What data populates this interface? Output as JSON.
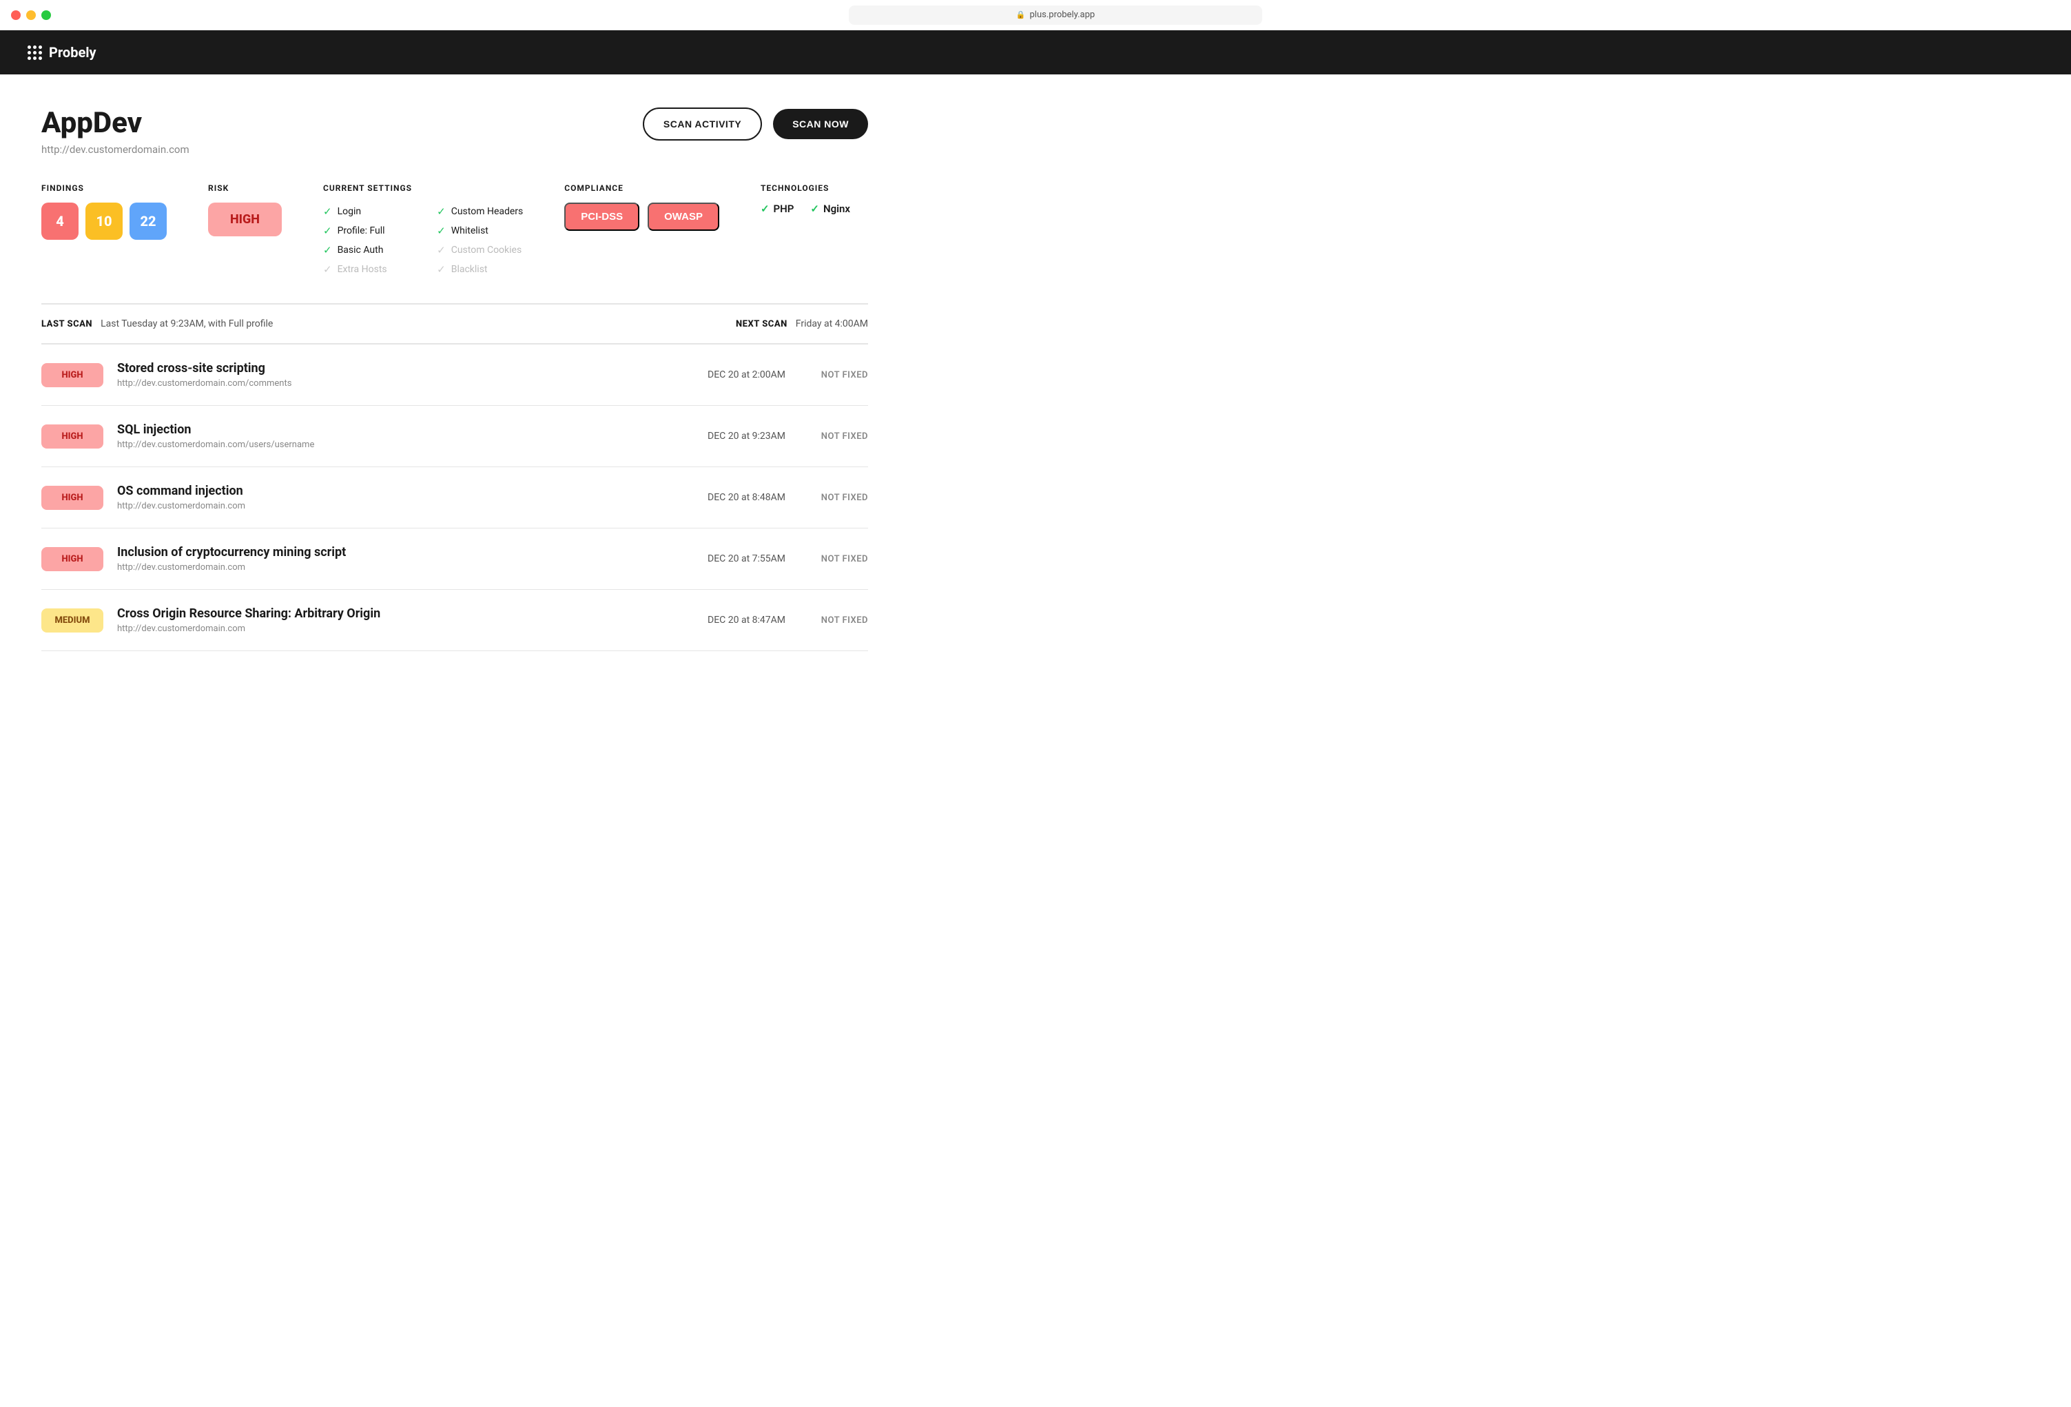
{
  "titlebar": {
    "url": "plus.probely.app"
  },
  "navbar": {
    "logo_text": "Probely"
  },
  "page": {
    "title": "AppDev",
    "subtitle": "http://dev.customerdomain.com",
    "scan_activity_label": "SCAN ACTIVITY",
    "scan_now_label": "SCAN NOW"
  },
  "findings_section": {
    "label": "FINDINGS",
    "red_count": "4",
    "orange_count": "10",
    "blue_count": "22"
  },
  "risk_section": {
    "label": "RISK",
    "value": "HIGH"
  },
  "current_settings": {
    "label": "CURRENT SETTINGS",
    "items": [
      {
        "id": "login",
        "label": "Login",
        "active": true
      },
      {
        "id": "custom-headers",
        "label": "Custom Headers",
        "active": true
      },
      {
        "id": "profile-full",
        "label": "Profile: Full",
        "active": true
      },
      {
        "id": "whitelist",
        "label": "Whitelist",
        "active": true
      },
      {
        "id": "basic-auth",
        "label": "Basic Auth",
        "active": true
      },
      {
        "id": "custom-cookies",
        "label": "Custom Cookies",
        "active": false
      },
      {
        "id": "extra-hosts",
        "label": "Extra Hosts",
        "active": false
      },
      {
        "id": "blacklist",
        "label": "Blacklist",
        "active": false
      }
    ]
  },
  "compliance_section": {
    "label": "COMPLIANCE",
    "badges": [
      {
        "id": "pci-dss",
        "label": "PCI-DSS"
      },
      {
        "id": "owasp",
        "label": "OWASP"
      }
    ]
  },
  "technologies_section": {
    "label": "TECHNOLOGIES",
    "items": [
      {
        "id": "php",
        "label": "PHP"
      },
      {
        "id": "nginx",
        "label": "Nginx"
      }
    ]
  },
  "scan_info": {
    "last_scan_label": "LAST SCAN",
    "last_scan_value": "Last Tuesday at 9:23AM, with Full profile",
    "next_scan_label": "NEXT SCAN",
    "next_scan_value": "Friday at 4:00AM"
  },
  "findings": [
    {
      "id": "finding-1",
      "severity": "HIGH",
      "severity_type": "high",
      "title": "Stored cross-site scripting",
      "url": "http://dev.customerdomain.com/comments",
      "date": "DEC 20 at 2:00AM",
      "status": "NOT FIXED"
    },
    {
      "id": "finding-2",
      "severity": "HIGH",
      "severity_type": "high",
      "title": "SQL injection",
      "url": "http://dev.customerdomain.com/users/username",
      "date": "DEC 20 at 9:23AM",
      "status": "NOT FIXED"
    },
    {
      "id": "finding-3",
      "severity": "HIGH",
      "severity_type": "high",
      "title": "OS command injection",
      "url": "http://dev.customerdomain.com",
      "date": "DEC 20 at 8:48AM",
      "status": "NOT FIXED"
    },
    {
      "id": "finding-4",
      "severity": "HIGH",
      "severity_type": "high",
      "title": "Inclusion of cryptocurrency mining script",
      "url": "http://dev.customerdomain.com",
      "date": "DEC 20 at 7:55AM",
      "status": "NOT FIXED"
    },
    {
      "id": "finding-5",
      "severity": "MEDIUM",
      "severity_type": "medium",
      "title": "Cross Origin Resource Sharing: Arbitrary Origin",
      "url": "http://dev.customerdomain.com",
      "date": "DEC 20 at 8:47AM",
      "status": "NOT FIXED"
    }
  ]
}
